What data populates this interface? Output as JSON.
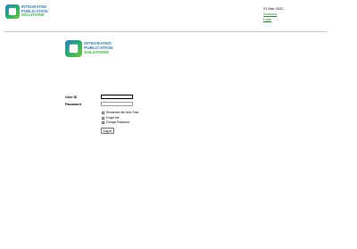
{
  "header": {
    "logo": {
      "line1": "INTEGRATED",
      "line2": "PUBLICATION",
      "line3": "SOLUTIONS"
    },
    "date": "21 Mar 2022",
    "links": [
      {
        "label": "Sessions"
      },
      {
        "label": "Login"
      }
    ]
  },
  "login": {
    "logo": {
      "line1": "INTEGRATED",
      "line2": "PUBLICATION",
      "line3": "SOLUTIONS"
    },
    "user_id_label": "User ID",
    "password_label": "Password",
    "user_id_value": "",
    "password_value": "",
    "options": [
      {
        "label": "Remember Me Next Time",
        "checked": false
      },
      {
        "label": "Forgot Me",
        "checked": false
      },
      {
        "label": "Change Password",
        "checked": false
      }
    ],
    "submit_label": "Log In"
  },
  "colors": {
    "logo_green": "#3fae49",
    "logo_blue": "#3a7dab",
    "link_green": "#2e7d32",
    "divider": "#c8c8c8"
  }
}
